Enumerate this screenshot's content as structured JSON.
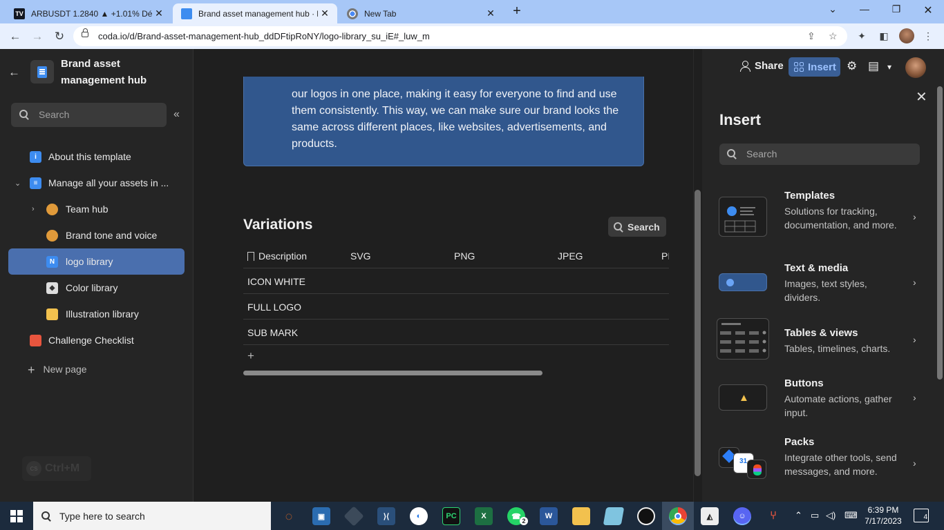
{
  "browser": {
    "tabs": [
      {
        "title": "ARBUSDT 1.2840 ▲ +1.01% Délc",
        "favicon": "TV"
      },
      {
        "title": "Brand asset management hub · lc",
        "favicon": "doc"
      },
      {
        "title": "New Tab",
        "favicon": "chrome"
      }
    ],
    "url": "coda.io/d/Brand-asset-management-hub_ddDFtipRoNY/logo-library_su_iE#_luw_m"
  },
  "sidebar": {
    "doc_title": "Brand asset management hub",
    "search_placeholder": "Search",
    "items": [
      {
        "label": "About this template",
        "icon": "info-icon",
        "color": "#3d8cf0"
      },
      {
        "label": "Manage all your assets in ...",
        "icon": "doc-icon",
        "color": "#3d8cf0"
      },
      {
        "label": "Team hub",
        "icon": "people-icon",
        "color": "#e09a3a"
      },
      {
        "label": "Brand tone and voice",
        "icon": "person-icon",
        "color": "#e09a3a"
      },
      {
        "label": "logo library",
        "icon": "n-logo-icon",
        "color": "#3d8cf0"
      },
      {
        "label": "Color library",
        "icon": "paint-bucket-icon",
        "color": "#ddd"
      },
      {
        "label": "Illustration library",
        "icon": "folder-icon",
        "color": "#f2c14e"
      },
      {
        "label": "Challenge Checklist",
        "icon": "checklist-icon",
        "color": "#e8553e"
      }
    ],
    "new_page": "New page",
    "shortcut_badge": "CS",
    "shortcut": "Ctrl+M"
  },
  "main": {
    "callout_text": "our logos in one place, making it easy for everyone to find and use them consistently. This way, we can make sure our brand looks the same across different places, like websites, advertisements, and products.",
    "section_title": "Variations",
    "search_label": "Search",
    "columns": [
      "Description",
      "SVG",
      "PNG",
      "JPEG",
      "PI"
    ],
    "rows": [
      "ICON WHITE",
      "FULL LOGO",
      "SUB MARK"
    ],
    "add_row": "+"
  },
  "header": {
    "share": "Share",
    "insert": "Insert"
  },
  "insert_panel": {
    "title": "Insert",
    "search_placeholder": "Search",
    "cards": [
      {
        "title": "Templates",
        "desc": "Solutions for tracking, documentation, and more."
      },
      {
        "title": "Text & media",
        "desc": "Images, text styles, dividers."
      },
      {
        "title": "Tables & views",
        "desc": "Tables, timelines, charts."
      },
      {
        "title": "Buttons",
        "desc": "Automate actions, gather input."
      },
      {
        "title": "Packs",
        "desc": "Integrate other tools, send messages, and more."
      }
    ]
  },
  "taskbar": {
    "search_placeholder": "Type here to search",
    "time": "6:39 PM",
    "date": "7/17/2023",
    "notifications": "4",
    "whatsapp_badge": "2"
  }
}
